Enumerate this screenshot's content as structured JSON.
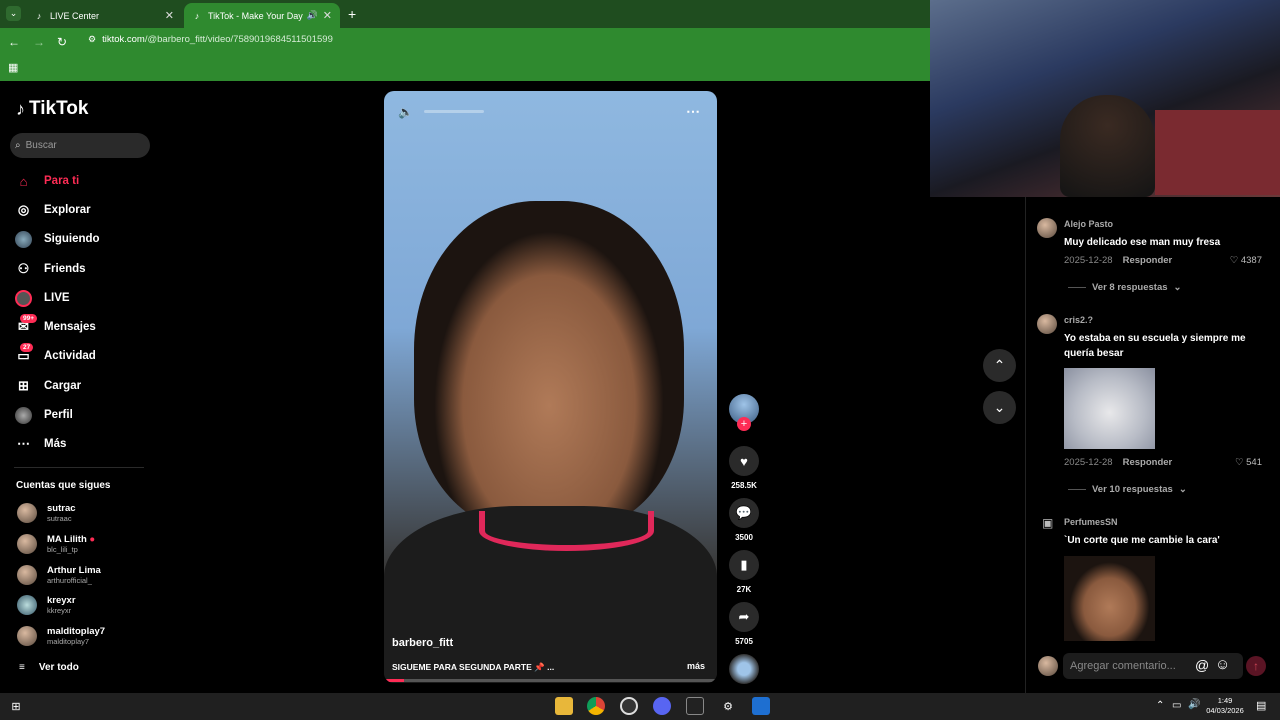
{
  "browser": {
    "tabs": [
      {
        "title": "LIVE Center"
      },
      {
        "title": "TikTok - Make Your Day"
      }
    ],
    "url_host": "tiktok.com",
    "url_path": "/@barbero_fitt/video/7589019684511501599"
  },
  "sidebar": {
    "brand": "TikTok",
    "search_placeholder": "Buscar",
    "nav": [
      {
        "label": "Para ti",
        "icon": "home-icon",
        "active": true
      },
      {
        "label": "Explorar",
        "icon": "compass-icon"
      },
      {
        "label": "Siguiendo",
        "icon": "following-avatar-icon"
      },
      {
        "label": "Friends",
        "icon": "friends-icon"
      },
      {
        "label": "LIVE",
        "icon": "live-icon"
      },
      {
        "label": "Mensajes",
        "icon": "messages-icon",
        "badge": "99+"
      },
      {
        "label": "Actividad",
        "icon": "activity-icon",
        "badge": "27"
      },
      {
        "label": "Cargar",
        "icon": "upload-icon"
      },
      {
        "label": "Perfil",
        "icon": "profile-avatar-icon"
      },
      {
        "label": "Más",
        "icon": "more-dots-icon"
      }
    ],
    "following_title": "Cuentas que sigues",
    "accounts": [
      {
        "name": "sutrac",
        "handle": "sutraac"
      },
      {
        "name": "MA   Lilith",
        "handle": "blc_lili_tp"
      },
      {
        "name": "Arthur Lima",
        "handle": "arthurofficial_"
      },
      {
        "name": "kreyxr",
        "handle": "kkreyxr"
      },
      {
        "name": "malditoplay7",
        "handle": "malditoplay7"
      }
    ],
    "see_all": "Ver todo"
  },
  "video": {
    "author": "barbero_fitt",
    "caption": "SIGUEME PARA SEGUNDA PARTE 📌 ...",
    "more": "más",
    "progress": 0.06
  },
  "actions": {
    "likes": "258.5K",
    "comments": "3500",
    "saves": "27K",
    "shares": "5705"
  },
  "comments": [
    {
      "user": "Alejo Pasto",
      "text": "Muy delicado ese man muy fresa",
      "date": "2025-12-28",
      "reply": "Responder",
      "likes": "4387",
      "replies": "Ver 8 respuestas"
    },
    {
      "user": "cris2.?",
      "text": "Yo estaba en su escuela y siempre me quería besar",
      "date": "2025-12-28",
      "reply": "Responder",
      "likes": "541",
      "replies": "Ver 10 respuestas"
    },
    {
      "user": "PerfumesSN",
      "text": "`Un corte que me cambie la cara'"
    }
  ],
  "comment_input_placeholder": "Agregar comentario...",
  "taskbar": {
    "time": "1:49",
    "date": "04/03/2026"
  },
  "colors": {
    "accent": "#fe2c55",
    "tab_bar": "#1f4d1f",
    "address_bar": "#2f8a2f"
  }
}
